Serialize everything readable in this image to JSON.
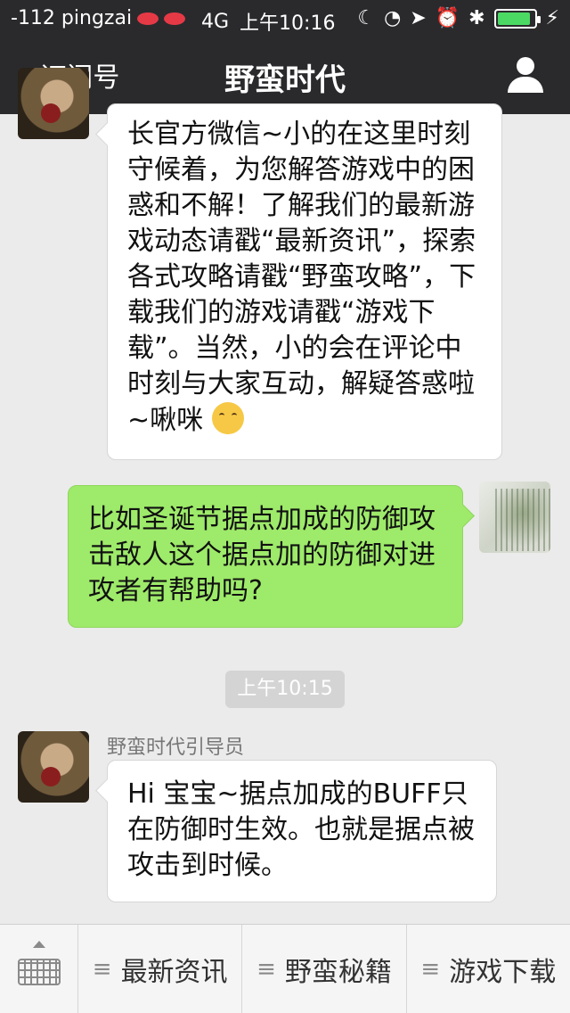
{
  "status": {
    "carrier": "-112 pingzai",
    "network": "4G",
    "time": "上午10:16"
  },
  "nav": {
    "back_label": "订阅号",
    "title": "野蛮时代"
  },
  "messages": {
    "first_incoming_text": "长官方微信~小的在这里时刻守候着，为您解答游戏中的困惑和不解！了解我们的最新游戏动态请戳“最新资讯”，探索各式攻略请戳“野蛮攻略”，下载我们的游戏请戳“游戏下载”。当然，小的会在评论中时刻与大家互动，解疑答惑啦~啾咪",
    "user_outgoing_text": "比如圣诞节据点加成的防御攻击敌人这个据点加的防御对进攻者有帮助吗?",
    "timestamp": "上午10:15",
    "guide_sender_name": "野蛮时代引导员",
    "guide_reply_text": "Hi 宝宝~据点加成的BUFF只在防御时生效。也就是据点被攻击到时候。"
  },
  "menu": {
    "items": [
      {
        "label": "最新资讯"
      },
      {
        "label": "野蛮秘籍"
      },
      {
        "label": "游戏下载"
      }
    ]
  }
}
